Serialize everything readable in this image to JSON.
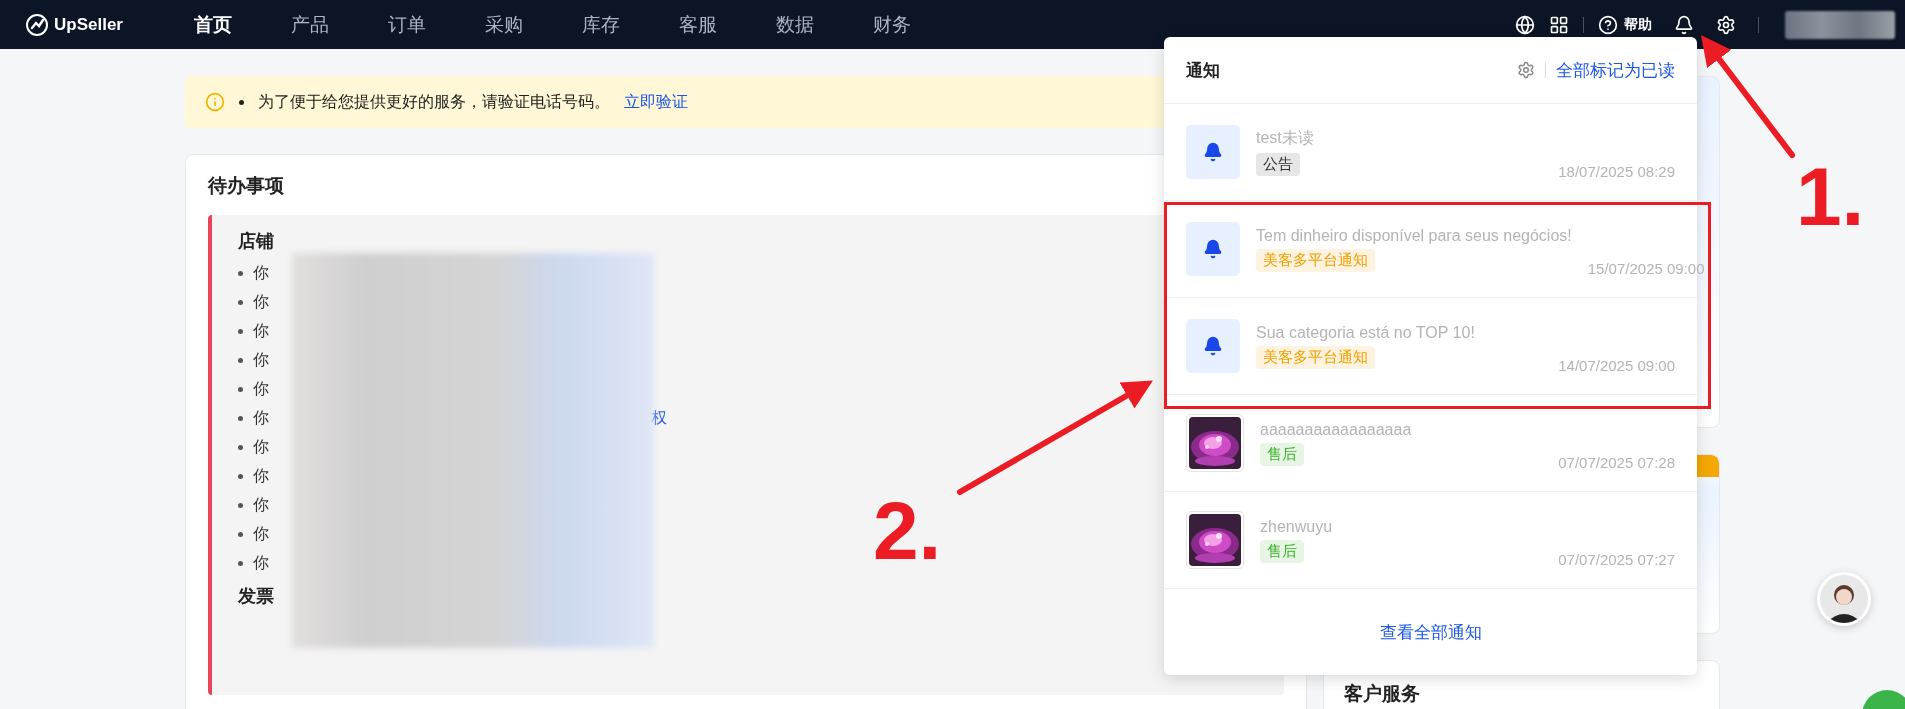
{
  "nav": {
    "logo": "UpSeller",
    "menu": [
      {
        "label": "首页",
        "selected": true
      },
      {
        "label": "产品",
        "selected": false
      },
      {
        "label": "订单",
        "selected": false
      },
      {
        "label": "采购",
        "selected": false
      },
      {
        "label": "库存",
        "selected": false
      },
      {
        "label": "客服",
        "selected": false
      },
      {
        "label": "数据",
        "selected": false
      },
      {
        "label": "财务",
        "selected": false
      }
    ],
    "help": "帮助"
  },
  "alert": {
    "message": "为了便于给您提供更好的服务，请验证电话号码。",
    "link": "立即验证"
  },
  "todo": {
    "title": "待办事项",
    "sections": [
      {
        "heading": "店铺",
        "items": [
          {
            "text": "你"
          },
          {
            "text": "你"
          },
          {
            "text": "你"
          },
          {
            "text": "你"
          },
          {
            "text": "你"
          },
          {
            "text": "你",
            "link": "权"
          },
          {
            "text": "你"
          },
          {
            "text": "你"
          },
          {
            "text": "你"
          },
          {
            "text": "你"
          },
          {
            "text": "你"
          }
        ]
      },
      {
        "heading": "发票"
      }
    ]
  },
  "right_cards": [
    {
      "kind": "plain"
    },
    {
      "kind": "tagged"
    },
    {
      "kind": "titled",
      "title": "客户服务"
    }
  ],
  "notifications": {
    "title": "通知",
    "mark_all": "全部标记为已读",
    "items": [
      {
        "kind": "bell",
        "title": "test未读",
        "tag": {
          "text": "公告",
          "color": "#333333"
        },
        "time": "18/07/2025 08:29"
      },
      {
        "kind": "bell",
        "title": "Tem dinheiro disponível para seus negócios!",
        "tag": {
          "text": "美客多平台通知",
          "color": "#f0a000"
        },
        "time": "15/07/2025 09:00"
      },
      {
        "kind": "bell",
        "title": "Sua categoria está no TOP 10!",
        "tag": {
          "text": "美客多平台通知",
          "color": "#f0a000"
        },
        "time": "14/07/2025 09:00"
      },
      {
        "kind": "picture",
        "title": "aaaaaaaaaaaaaaaaa",
        "tag": {
          "text": "售后",
          "color": "#3bb02a"
        },
        "time": "07/07/2025 07:28"
      },
      {
        "kind": "picture",
        "title": "zhenwuyu",
        "tag": {
          "text": "售后",
          "color": "#3bb02a"
        },
        "time": "07/07/2025 07:27"
      }
    ],
    "footer": "查看全部通知"
  },
  "annotations": [
    {
      "label": "1."
    },
    {
      "label": "2."
    }
  ]
}
